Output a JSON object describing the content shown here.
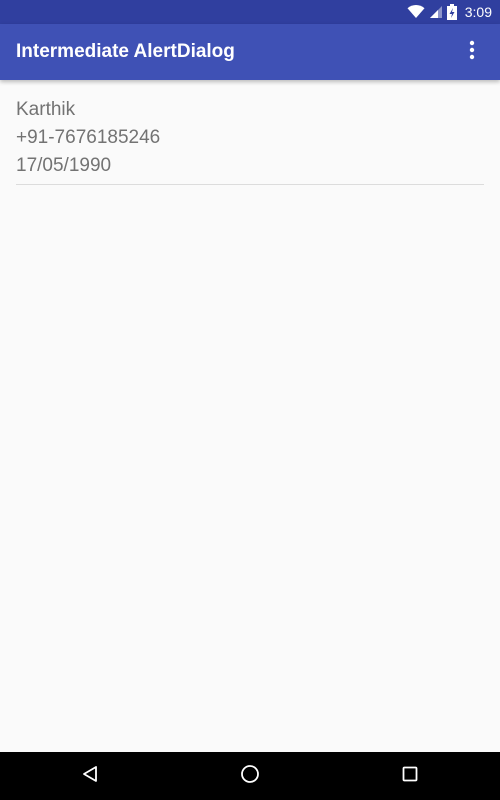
{
  "status_bar": {
    "time": "3:09",
    "icons": [
      "wifi-icon",
      "signal-icon",
      "battery-charging-icon"
    ]
  },
  "app_bar": {
    "title": "Intermediate AlertDialog",
    "overflow_icon": "more-vert-icon"
  },
  "contacts": [
    {
      "name": "Karthik",
      "phone": "+91-7676185246",
      "dob": "17/05/1990"
    }
  ],
  "nav_bar": {
    "icons": [
      "back-icon",
      "home-icon",
      "recents-icon"
    ]
  },
  "colors": {
    "status_bar": "#303f9f",
    "app_bar": "#3f51b5",
    "background": "#fafafa",
    "text_secondary": "#737373"
  }
}
